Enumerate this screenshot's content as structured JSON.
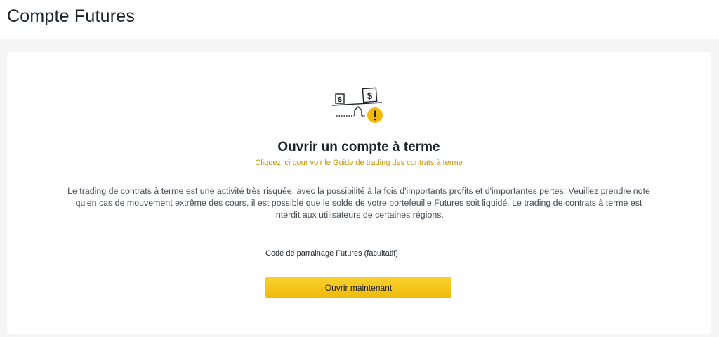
{
  "header": {
    "title": "Compte Futures"
  },
  "card": {
    "illustration_icon": "balance-scale-warning-icon",
    "title": "Ouvrir un compte à terme",
    "guide_link": "Cliquez ici pour voir le Guide de trading des contrats à terme",
    "disclaimer": "Le trading de contrats à terme est une activité très risquée, avec la possibilité à la fois d'importants profits et d'importantes pertes. Veuillez prendre note qu'en cas de mouvement extrême des cours, il est possible que le solde de votre portefeuille Futures soit liquidé. Le trading de contrats à terme est interdit aux utilisateurs de certaines régions.",
    "referral": {
      "placeholder": "Code de parrainage Futures (facultatif)",
      "value": ""
    },
    "open_button_label": "Ouvrir maintenant"
  },
  "colors": {
    "accent": "#F0B90B",
    "link": "#C99400",
    "text_primary": "#1E2329",
    "text_secondary": "#474D57",
    "background": "#F5F5F5"
  }
}
